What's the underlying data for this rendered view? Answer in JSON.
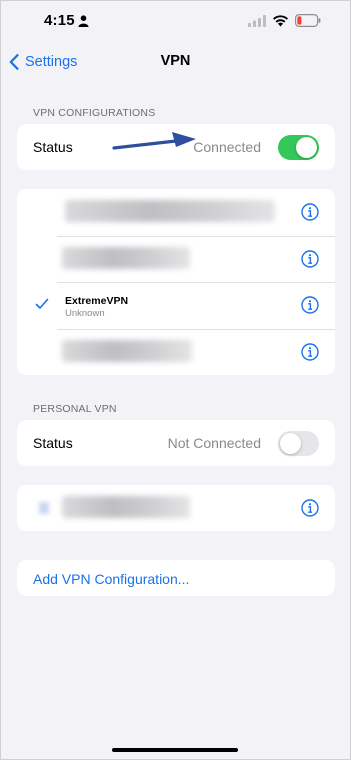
{
  "status_bar": {
    "time": "4:15"
  },
  "nav": {
    "back_label": "Settings",
    "title": "VPN"
  },
  "vpn_configurations": {
    "header": "VPN CONFIGURATIONS",
    "status_label": "Status",
    "status_value": "Connected",
    "toggle_on": true
  },
  "configs": [
    {
      "name": "",
      "subtitle": "",
      "selected": false,
      "redacted": true
    },
    {
      "name": "",
      "subtitle": "",
      "selected": false,
      "redacted": true
    },
    {
      "name": "ExtremeVPN",
      "subtitle": "Unknown",
      "selected": true,
      "redacted": false
    },
    {
      "name": "",
      "subtitle": "",
      "selected": false,
      "redacted": true
    }
  ],
  "personal_vpn": {
    "header": "PERSONAL VPN",
    "status_label": "Status",
    "status_value": "Not Connected",
    "toggle_on": false
  },
  "personal_configs": [
    {
      "name": "",
      "redacted": true
    }
  ],
  "add_config_label": "Add VPN Configuration...",
  "colors": {
    "accent": "#1b72e8",
    "toggle_on": "#34c759",
    "toggle_off": "#e6e6ea",
    "background": "#f2f2f7",
    "annotation_arrow": "#2f4f9e"
  }
}
